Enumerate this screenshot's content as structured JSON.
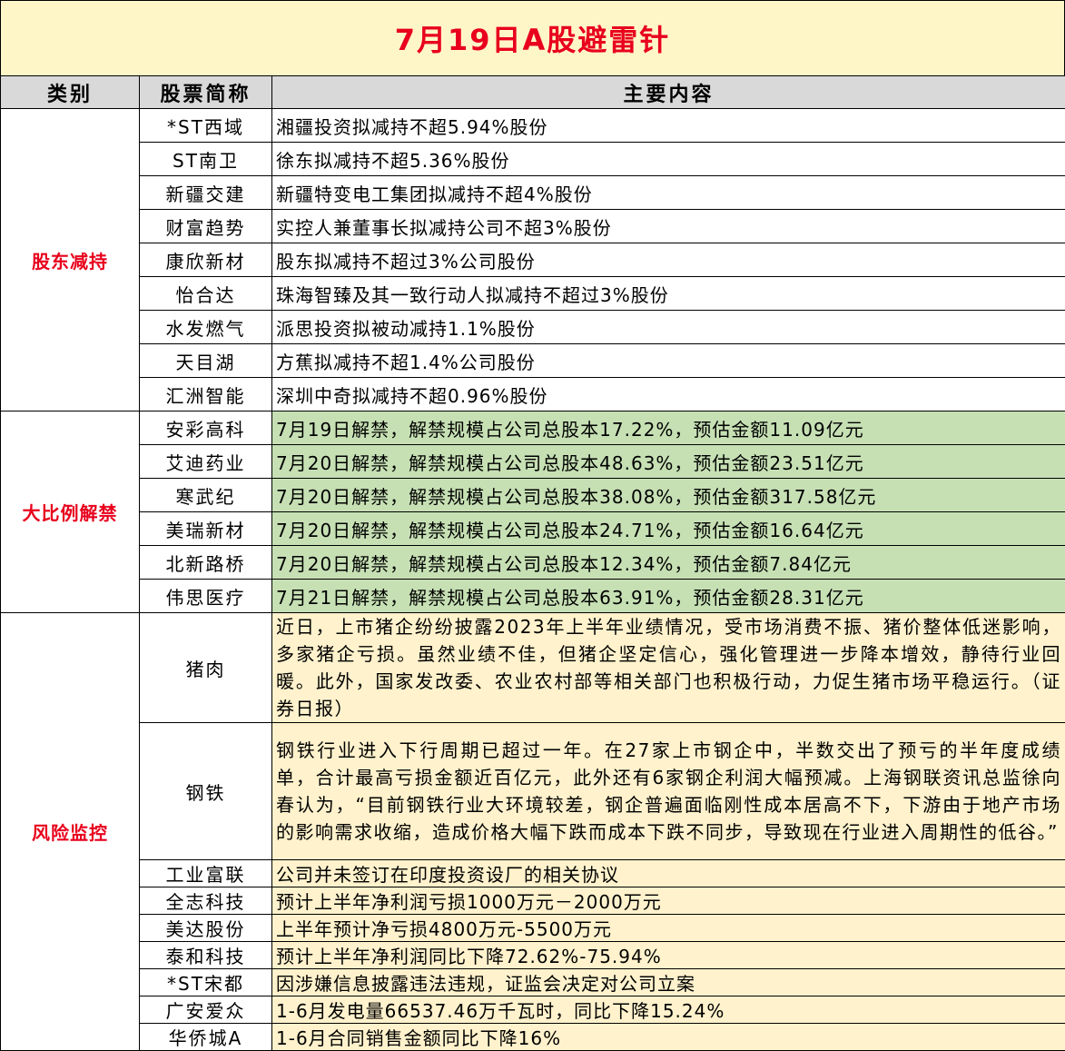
{
  "title": "7月19日A股避雷针",
  "headers": {
    "category": "类别",
    "stock": "股票简称",
    "content": "主要内容"
  },
  "groups": {
    "reduce": {
      "category": "股东减持",
      "rows": [
        {
          "name": "*ST西域",
          "content": "湘疆投资拟减持不超5.94%股份"
        },
        {
          "name": "ST南卫",
          "content": "徐东拟减持不超5.36%股份"
        },
        {
          "name": "新疆交建",
          "content": "新疆特变电工集团拟减持不超4%股份"
        },
        {
          "name": "财富趋势",
          "content": "实控人兼董事长拟减持公司不超3%股份"
        },
        {
          "name": "康欣新材",
          "content": "股东拟减持不超过3%公司股份"
        },
        {
          "name": "怡合达",
          "content": "珠海智臻及其一致行动人拟减持不超过3%股份"
        },
        {
          "name": "水发燃气",
          "content": "派思投资拟被动减持1.1%股份"
        },
        {
          "name": "天目湖",
          "content": "方蕉拟减持不超1.4%公司股份"
        },
        {
          "name": "汇洲智能",
          "content": "深圳中奇拟减持不超0.96%股份"
        }
      ]
    },
    "unlock": {
      "category": "大比例解禁",
      "rows": [
        {
          "name": "安彩高科",
          "content": "7月19日解禁，解禁规模占公司总股本17.22%，预估金额11.09亿元"
        },
        {
          "name": "艾迪药业",
          "content": "7月20日解禁，解禁规模占公司总股本48.63%，预估金额23.51亿元"
        },
        {
          "name": "寒武纪",
          "content": "7月20日解禁，解禁规模占公司总股本38.08%，预估金额317.58亿元"
        },
        {
          "name": "美瑞新材",
          "content": "7月20日解禁，解禁规模占公司总股本24.71%，预估金额16.64亿元"
        },
        {
          "name": "北新路桥",
          "content": "7月20日解禁，解禁规模占公司总股本12.34%，预估金额7.84亿元"
        },
        {
          "name": "伟思医疗",
          "content": "7月21日解禁，解禁规模占公司总股本63.91%，预估金额28.31亿元"
        }
      ]
    },
    "risk": {
      "category": "风险监控",
      "rows": [
        {
          "name": "猪肉",
          "content": "近日，上市猪企纷纷披露2023年上半年业绩情况，受市场消费不振、猪价整体低迷影响，多家猪企亏损。虽然业绩不佳，但猪企坚定信心，强化管理进一步降本增效，静待行业回暖。此外，国家发改委、农业农村部等相关部门也积极行动，力促生猪市场平稳运行。（证券日报）"
        },
        {
          "name": "钢铁",
          "content": "钢铁行业进入下行周期已超过一年。在27家上市钢企中，半数交出了预亏的半年度成绩单，合计最高亏损金额近百亿元，此外还有6家钢企利润大幅预减。上海钢联资讯总监徐向春认为，“目前钢铁行业大环境较差，钢企普遍面临刚性成本居高不下，下游由于地产市场的影响需求收缩，造成价格大幅下跌而成本下跌不同步，导致现在行业进入周期性的低谷。”"
        },
        {
          "name": "工业富联",
          "content": "公司并未签订在印度投资设厂的相关协议"
        },
        {
          "name": "全志科技",
          "content": "预计上半年净利润亏损1000万元－2000万元"
        },
        {
          "name": "美达股份",
          "content": "上半年预计净亏损4800万元-5500万元"
        },
        {
          "name": "泰和科技",
          "content": "预计上半年净利润同比下降72.62%-75.94%"
        },
        {
          "name": "*ST宋都",
          "content": "因涉嫌信息披露违法违规，证监会决定对公司立案"
        },
        {
          "name": "广安爱众",
          "content": "1-6月发电量66537.46万千瓦时，同比下降15.24%"
        },
        {
          "name": "华侨城A",
          "content": "1-6月合同销售金额同比下降16%"
        }
      ]
    }
  },
  "colors": {
    "title_bg": "#fff6c8",
    "title_text": "#e8001c",
    "header_bg": "#d9d9d9",
    "unlock_bg": "#c6e0b4",
    "risk_bg": "#fff2cc",
    "category_text": "#e8001c"
  }
}
